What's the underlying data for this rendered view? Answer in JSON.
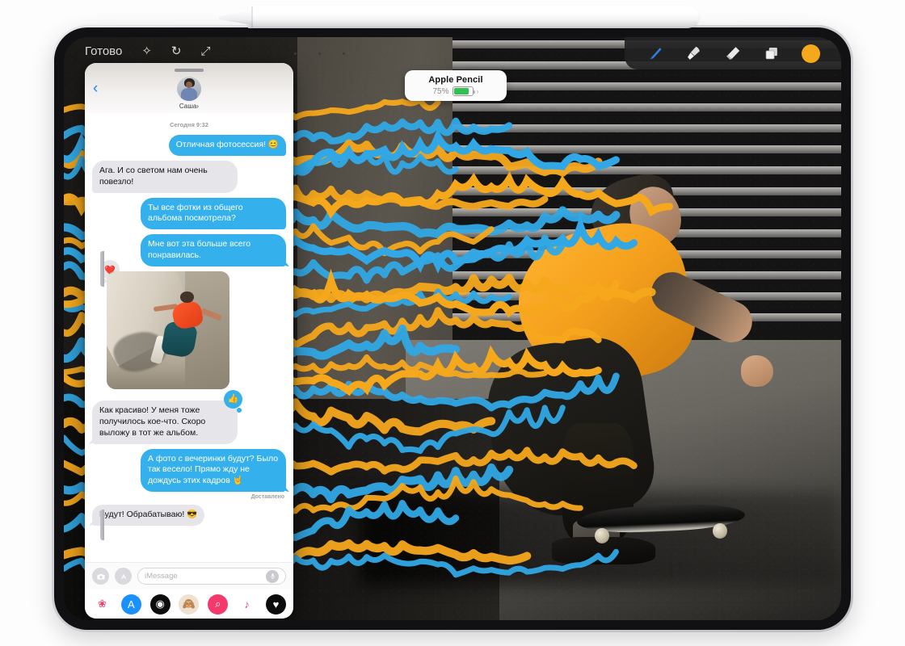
{
  "device": {
    "name": "iPad Pro",
    "accessory": "Apple Pencil"
  },
  "pencil_pill": {
    "title": "Apple Pencil",
    "battery_percent": "75%",
    "battery_level": 75,
    "chevron": "›"
  },
  "markup_toolbar": {
    "tools": [
      {
        "name": "pen-tool",
        "label": "Pen",
        "selected": true,
        "color": "#2f7fe0"
      },
      {
        "name": "marker-tool",
        "label": "Marker",
        "selected": false,
        "color": "#d8d8d8"
      },
      {
        "name": "eraser-tool",
        "label": "Eraser",
        "selected": false,
        "color": "#e4e4e4"
      },
      {
        "name": "layers-tool",
        "label": "Layers",
        "selected": false,
        "color": "#d2d2d2"
      }
    ],
    "active_color": "#f5a81c",
    "active_color_label": "Yellow"
  },
  "messages": {
    "back_label": "‹",
    "contact_name": "Саша",
    "contact_chevron": "›",
    "daystamp": "Сегодня 9:32",
    "delivered_label": "Доставлено",
    "thread": [
      {
        "side": "out",
        "text": "Отличная фотосессия! 😊"
      },
      {
        "side": "in",
        "text": "Ага. И со светом нам очень повезло!"
      },
      {
        "side": "out",
        "text": "Ты все фотки из общего альбома посмотрела?"
      },
      {
        "side": "out",
        "text": "Мне вот эта больше всего понравилась."
      },
      {
        "side": "in",
        "type": "photo",
        "tapback": "❤️",
        "caption": ""
      },
      {
        "side": "in",
        "text": "Как красиво! У меня тоже получилось кое-что. Скоро выложу в тот же альбом.",
        "tapback_like": "👍"
      },
      {
        "side": "out",
        "text": "А фото с вечеринки будут? Было так весело! Прямо жду не дождусь этих кадров 🤘"
      },
      {
        "side": "in",
        "text": "Будут! Обрабатываю! 😎"
      }
    ],
    "composer": {
      "camera_icon": "camera-icon",
      "apps_icon": "app-store-icon",
      "placeholder": "iMessage",
      "mic_icon": "microphone-icon"
    },
    "app_drawer": [
      {
        "name": "photos-app-icon",
        "glyph": "❀",
        "bg": "#ffffff"
      },
      {
        "name": "app-store-icon",
        "glyph": "A",
        "bg": "#1b90ff"
      },
      {
        "name": "music-record-icon",
        "glyph": "◉",
        "bg": "#0c0c0c"
      },
      {
        "name": "memoji-icon",
        "glyph": "🙈",
        "bg": "#efe0cf"
      },
      {
        "name": "images-search-icon",
        "glyph": "⌕",
        "bg": "#f4396b"
      },
      {
        "name": "music-note-icon",
        "glyph": "♪",
        "bg": "#ffffff"
      },
      {
        "name": "digital-touch-icon",
        "glyph": "♥",
        "bg": "#0c0c0c"
      }
    ]
  },
  "canvas": {
    "artwork_title": "Skateboarder photo with Apple Pencil markup",
    "stroke_colors": {
      "yellow": "#f5a81c",
      "blue": "#31a8e5"
    },
    "subject": "skateboarder"
  }
}
